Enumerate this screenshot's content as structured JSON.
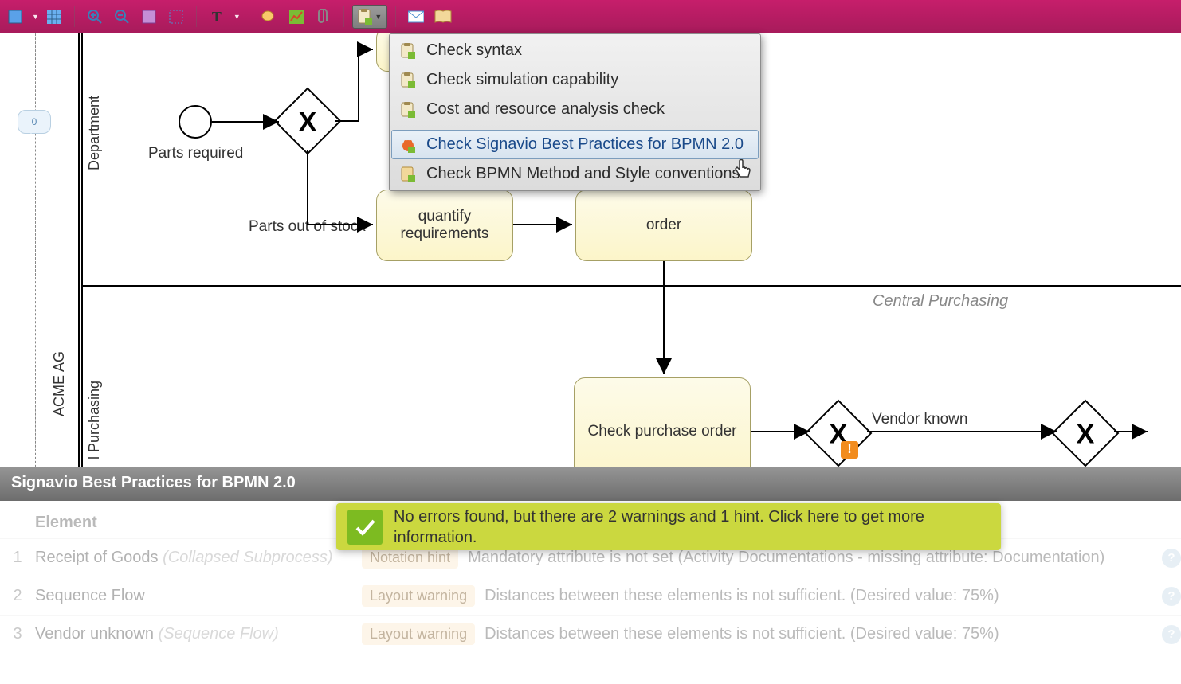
{
  "toolbar": {
    "icons": [
      "align",
      "grid",
      "zoom-in",
      "zoom-out",
      "fit",
      "region",
      "text",
      "chat",
      "chart",
      "attach",
      "checklist",
      "mail",
      "book"
    ]
  },
  "menu": {
    "items": [
      {
        "label": "Check syntax",
        "icon": "clipboard"
      },
      {
        "label": "Check simulation capability",
        "icon": "clipboard"
      },
      {
        "label": "Cost and resource analysis check",
        "icon": "clipboard"
      },
      {
        "label": "Check Signavio Best Practices for BPMN 2.0",
        "icon": "bug",
        "hover": true
      },
      {
        "label": "Check BPMN Method and Style conventions",
        "icon": "book"
      }
    ]
  },
  "diagram": {
    "pool_label": "ACME AG",
    "lane1_label": "Department",
    "lane2_label": "l Purchasing",
    "lane2_title": "Central Purchasing",
    "start_label": "Parts required",
    "edge_out_of_stock": "Parts out of stock",
    "task_requirements_line1": "quantify",
    "task_requirements_line2": "requirements",
    "task_order": "order",
    "task_check_po": "Check purchase order",
    "vendor_known": "Vendor known",
    "comment_count": "0"
  },
  "panel": {
    "title": "Signavio Best Practices for BPMN 2.0",
    "column": "Element",
    "rows": [
      {
        "n": "1",
        "element": "Receipt of Goods",
        "etype": "(Collapsed Subprocess)",
        "tag": "Notation hint",
        "msg": "Mandatory attribute is not set (Activity Documentations - missing attribute: Documentation)"
      },
      {
        "n": "2",
        "element": "Sequence Flow",
        "etype": "",
        "tag": "Layout warning",
        "msg": "Distances between these elements is not sufficient. (Desired value: 75%)"
      },
      {
        "n": "3",
        "element": "Vendor unknown",
        "etype": "(Sequence Flow)",
        "tag": "Layout warning",
        "msg": "Distances between these elements is not sufficient. (Desired value: 75%)"
      }
    ]
  },
  "notification": {
    "text": "No errors found, but there are 2 warnings and 1 hint. Click here to get more information."
  }
}
